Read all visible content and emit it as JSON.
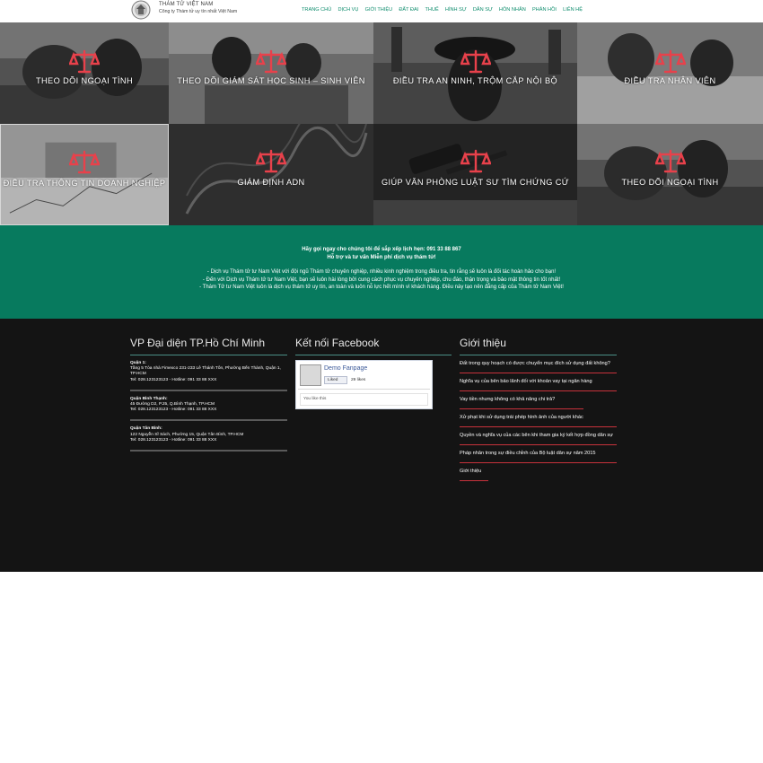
{
  "header": {
    "logo_name": "THÁM TỬ VIỆT NAM",
    "logo_tagline": "Công ty Thám tử uy tín nhất Việt Nam",
    "nav": [
      "TRANG CHỦ",
      "DỊCH VỤ",
      "GIỚI THIỆU",
      "ĐẤT ĐAI",
      "THUẾ",
      "HÌNH SỰ",
      "DÂN SỰ",
      "HÔN NHÂN",
      "PHẢN HỒI",
      "LIÊN HỆ"
    ]
  },
  "tiles": [
    {
      "label": "THEO DÕI NGOẠI TÌNH"
    },
    {
      "label": "THEO DÕI GIÁM SÁT HỌC SINH – SINH VIÊN"
    },
    {
      "label": "ĐIỀU TRA AN NINH, TRỘM CẮP NỘI BỘ"
    },
    {
      "label": "ĐIỀU TRA NHÂN VIÊN"
    },
    {
      "label": "ĐIỀU TRA THÔNG TIN DOANH NGHIỆP"
    },
    {
      "label": "GIÁM ĐỊNH ADN"
    },
    {
      "label": "GIÚP VĂN PHÒNG LUẬT SƯ TÌM CHỨNG CỨ"
    },
    {
      "label": "THEO DÕI NGOẠI TÌNH"
    }
  ],
  "band": {
    "line1": "Hãy gọi ngay cho chúng tôi để sắp xếp lịch hẹn: 091 33 88 867",
    "line2": "Hỗ trợ và tư vấn Miễn phí dịch vụ thám tử!",
    "line3": "- Dịch vụ Thám tử tư Nam Việt với đội ngũ Thám tử chuyên nghiệp, nhiều kinh nghiệm trong điều tra, tin rằng sẽ luôn là đối tác hoàn hảo cho bạn!",
    "line4": "- Đến với Dịch vụ Thám tử tư Nam Việt, bạn sẽ luôn hài lòng bởi cung cách phục vụ chuyên nghiệp, chu đáo, thận trọng và bảo mật thông tin tốt nhất!",
    "line5": "- Thám Tử tư Nam Việt luôn là dịch vụ thám tử uy tín, an toàn và luôn nỗ lực hết mình vì khách hàng. Điều này tạo nên đẳng cấp của Thám tử Nam Việt!"
  },
  "footer": {
    "offices_title": "VP Đại diện TP.Hồ Chí Minh",
    "offices": [
      {
        "name": "Quận 1:",
        "address": "Tầng 5 Tòa nhà Fimexco 231-233 Lê Thánh Tôn, Phường Bến Thành, Quận 1, TP.HCM",
        "phone": "Tel: 028.123123123 - Hotline: 091 33 88 XXX"
      },
      {
        "name": "Quận Bình Thạnh:",
        "address": "45 Đường D2, P.25, Q.Bình Thạnh, TP.HCM",
        "phone": "Tel: 028.123123123 - Hotline: 091 33 88 XXX"
      },
      {
        "name": "Quận Tân Bình:",
        "address": "122 Nguyễn Sĩ Sách, Phường 15, Quận Tân Bình, TP.HCM",
        "phone": "Tel: 028.123123123 - Hotline: 091 33 88 XXX"
      }
    ],
    "facebook_title": "Kết nối Facebook",
    "facebook": {
      "page_name": "Demo Fanpage",
      "like_label": "Liked",
      "like_count": "29 likes",
      "friends_text": "You like this"
    },
    "intro_title": "Giới thiệu",
    "posts": [
      "Đất trong quy hoạch có được chuyển mục đích sử dụng đất không?",
      "Nghĩa vụ của bên bảo lãnh đối với khoản vay tại ngân hàng",
      "Vay tiền nhưng không có khả năng chi trả?",
      "Xử phạt khi sử dụng trái phép hình ảnh của người khác",
      "Quyền và nghĩa vụ của các bên khi tham gia ký kết hợp đồng dân sự",
      "Pháp nhân trong sự điều chỉnh của Bộ luật dân sự năm 2015",
      "Giới thiệu"
    ]
  },
  "colors": {
    "accent_green": "#077a5e",
    "nav_green": "#0d8c6c",
    "footer_bg": "#141414",
    "scale_red": "#e8414b",
    "post_rule_red": "#c8323c"
  }
}
